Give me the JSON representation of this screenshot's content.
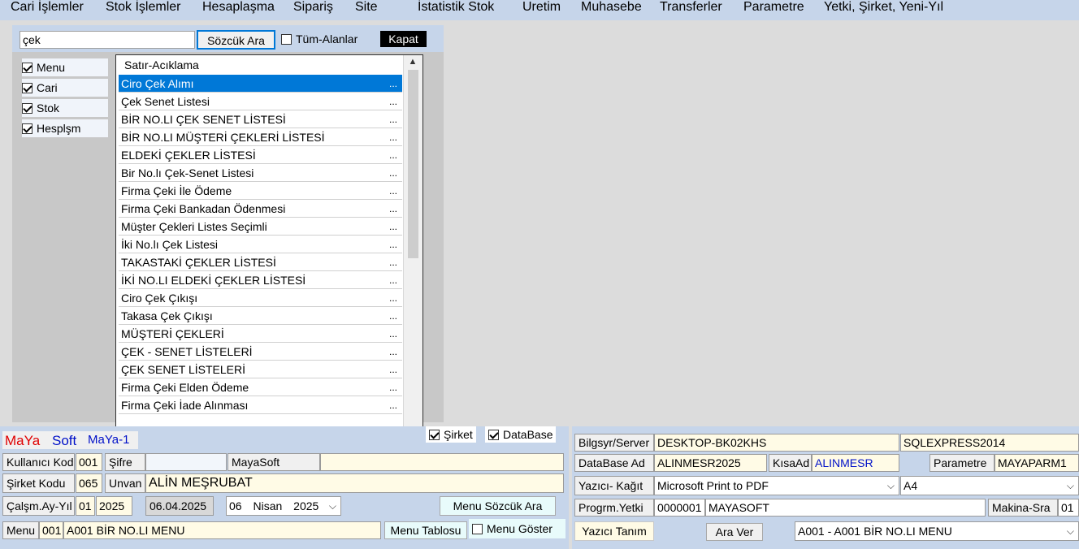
{
  "menubar": {
    "items": [
      "Cari İşlemler",
      "Stok İşlemler",
      "Hesaplaşma",
      "Sipariş",
      "Site",
      "İstatistik Stok",
      "Uretim",
      "Muhasebe",
      "Transferler",
      "Parametre",
      "Yetki, Şirket, Yeni-Yıl"
    ]
  },
  "search": {
    "query": "çek",
    "search_button": "Sözcük Ara",
    "all_fields_label": "Tüm-Alanlar",
    "close_button": "Kapat"
  },
  "filters": [
    {
      "label": "Menu",
      "checked": true
    },
    {
      "label": "Cari",
      "checked": true
    },
    {
      "label": "Stok",
      "checked": true
    },
    {
      "label": "Hesplşm",
      "checked": true
    }
  ],
  "results": {
    "header": "Satır-Acıklama",
    "rows": [
      {
        "label": "Ciro Çek Alımı",
        "dots": "...",
        "selected": true
      },
      {
        "label": "Çek Senet Listesi",
        "dots": "..."
      },
      {
        "label": "BİR NO.LI ÇEK SENET LİSTESİ",
        "dots": "..."
      },
      {
        "label": "BİR NO.LI MÜŞTERİ ÇEKLERİ LİSTESİ",
        "dots": "..."
      },
      {
        "label": "ELDEKİ ÇEKLER LİSTESİ",
        "dots": "..."
      },
      {
        "label": "Bir No.lı Çek-Senet Listesi",
        "dots": "..."
      },
      {
        "label": "Firma Çeki İle Ödeme",
        "dots": "..."
      },
      {
        "label": "Firma Çeki Bankadan Ödenmesi",
        "dots": "..."
      },
      {
        "label": "Müşter Çekleri Listes Seçimli",
        "dots": "..."
      },
      {
        "label": "İki No.lı Çek Listesi",
        "dots": "..."
      },
      {
        "label": "TAKASTAKİ ÇEKLER LİSTESİ",
        "dots": "..."
      },
      {
        "label": "İKİ NO.LI ELDEKİ ÇEKLER LİSTESİ",
        "dots": "..."
      },
      {
        "label": "Ciro Çek Çıkışı",
        "dots": "..."
      },
      {
        "label": "Takasa Çek Çıkışı",
        "dots": "..."
      },
      {
        "label": "MÜŞTERİ ÇEKLERİ",
        "dots": "..."
      },
      {
        "label": "ÇEK - SENET LİSTELERİ",
        "dots": "..."
      },
      {
        "label": "ÇEK SENET LİSTELERİ",
        "dots": "..."
      },
      {
        "label": "Firma Çeki Elden Ödeme",
        "dots": "..."
      },
      {
        "label": "Firma Çeki İade Alınması",
        "dots": "..."
      }
    ]
  },
  "brand": {
    "ma": "MaYa",
    "soft": "Soft",
    "version": "MaYa-1"
  },
  "company_chk": {
    "label": "Şirket",
    "checked": true
  },
  "database_chk": {
    "label": "DataBase",
    "checked": true
  },
  "user": {
    "code_label": "Kullanıcı Kod",
    "code": "001",
    "password_label": "Şifre",
    "password": "",
    "user_name": "MayaSoft"
  },
  "company": {
    "code_label": "Şirket Kodu",
    "code": "065",
    "title_label": "Unvan",
    "title": "ALİN MEŞRUBAT"
  },
  "period": {
    "label": "Çalşm.Ay-Yıl",
    "month": "01",
    "year": "2025",
    "date": "06.04.2025",
    "day": "06",
    "month_name": "Nisan",
    "year2": "2025"
  },
  "menu_search_button": "Menu Sözcük Ara",
  "menu": {
    "label": "Menu",
    "code": "001",
    "name": "A001  BİR NO.LI MENU",
    "table_button": "Menu Tablosu",
    "show_label": "Menu Göster"
  },
  "system": {
    "server_label": "Bilgsyr/Server",
    "server": "DESKTOP-BK02KHS",
    "instance": "SQLEXPRESS2014",
    "db_label": "DataBase Ad",
    "db": "ALINMESR2025",
    "short_label": "KısaAd",
    "short": "ALINMESR",
    "param_label": "Parametre",
    "param": "MAYAPARM1",
    "printer_label": "Yazıcı- Kağıt",
    "printer": "Microsoft Print to PDF",
    "paper": "A4",
    "auth_label": "Progrm.Yetki",
    "auth_code": "0000001",
    "auth_name": "MAYASOFT",
    "machine_label": "Makina-Sra",
    "machine": "01",
    "printer_def_button": "Yazıcı Tanım",
    "break_button": "Ara Ver",
    "menu_select": "A001 - A001  BİR NO.LI MENU"
  },
  "colors": {
    "accent": "#0078d7",
    "brand_red": "#e00000",
    "brand_blue": "#0010c8",
    "panel": "#c6d5ea",
    "cell": "#fffbe6"
  }
}
